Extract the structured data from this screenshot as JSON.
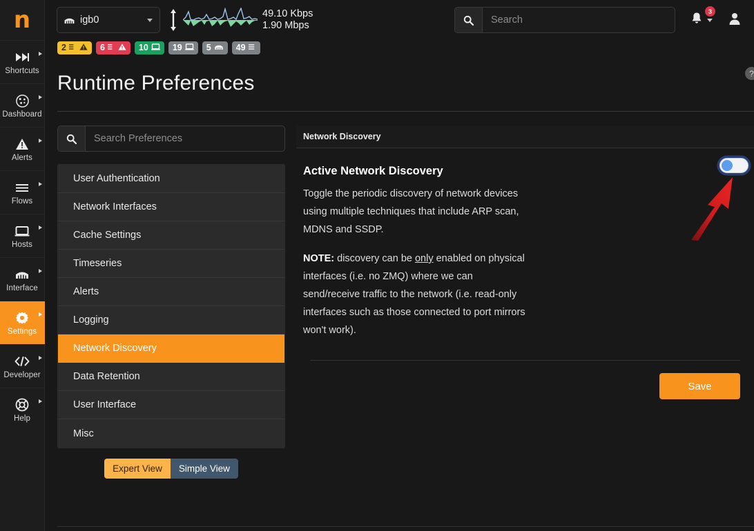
{
  "brand": {
    "logo_text": "n"
  },
  "sidebar": {
    "items": [
      {
        "label": "Shortcuts",
        "icon": "fast-forward-icon",
        "active": false
      },
      {
        "label": "Dashboard",
        "icon": "dashboard-icon",
        "active": false
      },
      {
        "label": "Alerts",
        "icon": "warning-triangle-icon",
        "active": false
      },
      {
        "label": "Flows",
        "icon": "list-lines-icon",
        "active": false
      },
      {
        "label": "Hosts",
        "icon": "monitor-icon",
        "active": false
      },
      {
        "label": "Interface",
        "icon": "network-card-icon",
        "active": false
      },
      {
        "label": "Settings",
        "icon": "gear-icon",
        "active": true
      },
      {
        "label": "Developer",
        "icon": "code-brackets-icon",
        "active": false
      },
      {
        "label": "Help",
        "icon": "lifebuoy-icon",
        "active": false
      }
    ]
  },
  "topbar": {
    "interface": {
      "name": "igb0",
      "icon": "network-card-icon"
    },
    "rates": {
      "down": "49.10 Kbps",
      "up": "1.90 Mbps"
    },
    "search": {
      "placeholder": "Search",
      "value": ""
    },
    "notifications": {
      "count": "3"
    }
  },
  "status_badges": [
    {
      "count": "2",
      "icon": "list-warning-icon",
      "color": "#f3c02c",
      "style": "amber"
    },
    {
      "count": "6",
      "icon": "list-error-icon",
      "color": "#e03c52",
      "style": "red"
    },
    {
      "count": "10",
      "icon": "device-icon",
      "color": "#17a260",
      "style": "green"
    },
    {
      "count": "19",
      "icon": "device-icon",
      "color": "#7d8287",
      "style": "gray"
    },
    {
      "count": "5",
      "icon": "network-card-icon",
      "color": "#7d8287",
      "style": "gray"
    },
    {
      "count": "49",
      "icon": "list-lines-icon",
      "color": "#7d8287",
      "style": "gray"
    }
  ],
  "page": {
    "title": "Runtime Preferences",
    "help_glyph": "?"
  },
  "preferences": {
    "search": {
      "placeholder": "Search Preferences",
      "value": ""
    },
    "items": [
      {
        "label": "User Authentication",
        "active": false
      },
      {
        "label": "Network Interfaces",
        "active": false
      },
      {
        "label": "Cache Settings",
        "active": false
      },
      {
        "label": "Timeseries",
        "active": false
      },
      {
        "label": "Alerts",
        "active": false
      },
      {
        "label": "Logging",
        "active": false
      },
      {
        "label": "Network Discovery",
        "active": true
      },
      {
        "label": "Data Retention",
        "active": false
      },
      {
        "label": "User Interface",
        "active": false
      },
      {
        "label": "Misc",
        "active": false
      }
    ],
    "view_toggle": {
      "expert_label": "Expert View",
      "simple_label": "Simple View",
      "selected": "Expert View"
    }
  },
  "detail": {
    "header": "Network Discovery",
    "setting_title": "Active Network Discovery",
    "description_p1": "Toggle the periodic discovery of network devices using multiple techniques that include ARP scan, MDNS and SSDP.",
    "note_label": "NOTE:",
    "note_text_before": " discovery can be ",
    "note_emphasis": "only",
    "note_text_after": " enabled on physical interfaces (i.e. no ZMQ) where we can send/receive traffic to the network (i.e. read-only interfaces such as those connected to port mirrors won't work).",
    "toggle_state": "off",
    "save_label": "Save"
  },
  "annotation": {
    "arrow_color": "#d82020",
    "points_to": "active-network-discovery-toggle"
  },
  "theme": {
    "accent": "#f8941d",
    "background": "#181818",
    "panel": "#2b2b2b",
    "toggle_knob": "#5c9ded"
  }
}
